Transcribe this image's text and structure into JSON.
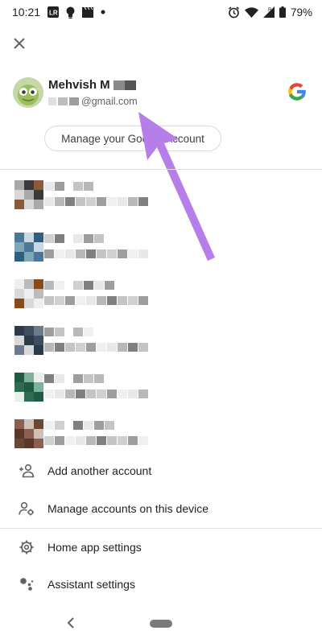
{
  "status_bar": {
    "time": "10:21",
    "battery": "79%",
    "icons": [
      "lr-icon",
      "bulb-icon",
      "clapper-icon",
      "dot-icon",
      "alarm-icon",
      "wifi-icon",
      "signal-icon",
      "battery-icon"
    ]
  },
  "header": {
    "close_icon": "close-icon"
  },
  "account": {
    "name": "Mehvish M",
    "email": "@gmail.com",
    "manage_label": "Manage your Google Account"
  },
  "other_accounts": {
    "count": 6
  },
  "menu": {
    "add_account": "Add another account",
    "manage_accounts": "Manage accounts on this device",
    "home_settings": "Home app settings",
    "assistant_settings": "Assistant settings"
  },
  "colors": {
    "arrow": "#b57ee8",
    "google_blue": "#4285F4",
    "google_red": "#EA4335",
    "google_yellow": "#FBBC05",
    "google_green": "#34A853"
  }
}
